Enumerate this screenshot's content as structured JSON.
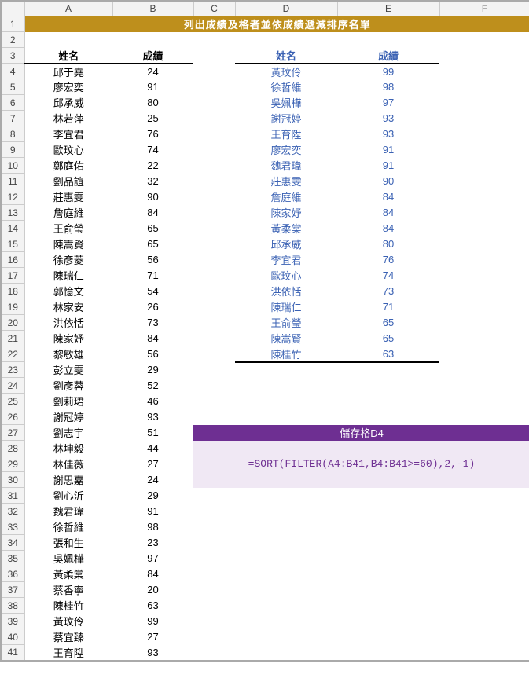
{
  "columns": [
    "A",
    "B",
    "C",
    "D",
    "E",
    "F"
  ],
  "title": "列出成績及格者並依成績遞減排序名單",
  "headers_ab": {
    "name": "姓名",
    "score": "成績"
  },
  "headers_de": {
    "name": "姓名",
    "score": "成績"
  },
  "formula_box": {
    "header": "儲存格D4",
    "body": "=SORT(FILTER(A4:B41,B4:B41>=60),2,-1)"
  },
  "chart_data": {
    "type": "table",
    "left": {
      "columns": [
        "姓名",
        "成績"
      ],
      "rows": [
        [
          "邱于堯",
          24
        ],
        [
          "廖宏奕",
          91
        ],
        [
          "邱承威",
          80
        ],
        [
          "林若萍",
          25
        ],
        [
          "李宜君",
          76
        ],
        [
          "歐玟心",
          74
        ],
        [
          "鄭庭佑",
          22
        ],
        [
          "劉品誼",
          32
        ],
        [
          "莊惠雯",
          90
        ],
        [
          "詹庭維",
          84
        ],
        [
          "王俞瑩",
          65
        ],
        [
          "陳嵩賢",
          65
        ],
        [
          "徐彥菱",
          56
        ],
        [
          "陳瑞仁",
          71
        ],
        [
          "郭憶文",
          54
        ],
        [
          "林家安",
          26
        ],
        [
          "洪依恬",
          73
        ],
        [
          "陳家妤",
          84
        ],
        [
          "黎敏雄",
          56
        ],
        [
          "彭立雯",
          29
        ],
        [
          "劉彥蓉",
          52
        ],
        [
          "劉莉珺",
          46
        ],
        [
          "謝冠婷",
          93
        ],
        [
          "劉志宇",
          51
        ],
        [
          "林坤毅",
          44
        ],
        [
          "林佳薇",
          27
        ],
        [
          "謝思嘉",
          24
        ],
        [
          "劉心沂",
          29
        ],
        [
          "魏君瑋",
          91
        ],
        [
          "徐哲維",
          98
        ],
        [
          "張和生",
          23
        ],
        [
          "吳姵樺",
          97
        ],
        [
          "黃柔棠",
          84
        ],
        [
          "蔡香寧",
          20
        ],
        [
          "陳桂竹",
          63
        ],
        [
          "黃玟伶",
          99
        ],
        [
          "蔡宜臻",
          27
        ],
        [
          "王育陞",
          93
        ]
      ]
    },
    "right": {
      "columns": [
        "姓名",
        "成績"
      ],
      "rows": [
        [
          "黃玟伶",
          99
        ],
        [
          "徐哲維",
          98
        ],
        [
          "吳姵樺",
          97
        ],
        [
          "謝冠婷",
          93
        ],
        [
          "王育陞",
          93
        ],
        [
          "廖宏奕",
          91
        ],
        [
          "魏君瑋",
          91
        ],
        [
          "莊惠雯",
          90
        ],
        [
          "詹庭維",
          84
        ],
        [
          "陳家妤",
          84
        ],
        [
          "黃柔棠",
          84
        ],
        [
          "邱承威",
          80
        ],
        [
          "李宜君",
          76
        ],
        [
          "歐玟心",
          74
        ],
        [
          "洪依恬",
          73
        ],
        [
          "陳瑞仁",
          71
        ],
        [
          "王俞瑩",
          65
        ],
        [
          "陳嵩賢",
          65
        ],
        [
          "陳桂竹",
          63
        ]
      ]
    }
  }
}
